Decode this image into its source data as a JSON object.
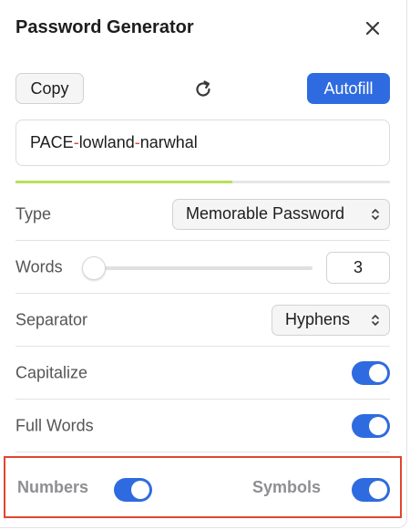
{
  "header": {
    "title": "Password Generator",
    "close_icon": "close-icon"
  },
  "toolbar": {
    "copy_label": "Copy",
    "refresh_icon": "refresh-icon",
    "autofill_label": "Autofill"
  },
  "password": {
    "parts": [
      "PACE",
      "-",
      "lowland",
      "-",
      "narwhal"
    ],
    "strength": 0.58
  },
  "options": {
    "type": {
      "label": "Type",
      "value": "Memorable Password"
    },
    "words": {
      "label": "Words",
      "value": "3",
      "slider_fraction": 0.0
    },
    "separator": {
      "label": "Separator",
      "value": "Hyphens"
    },
    "capitalize": {
      "label": "Capitalize",
      "enabled": true
    },
    "full_words": {
      "label": "Full Words",
      "enabled": true
    },
    "numbers": {
      "label": "Numbers",
      "enabled": true
    },
    "symbols": {
      "label": "Symbols",
      "enabled": true
    }
  },
  "colors": {
    "accent": "#2f6be0",
    "separator_char": "#e0453a",
    "strength": "#b9e05a",
    "highlight_border": "#e0462d"
  }
}
